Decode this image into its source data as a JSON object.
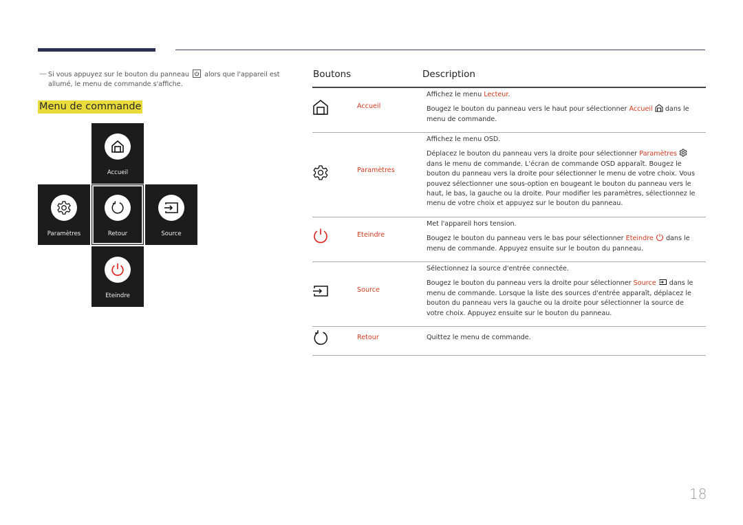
{
  "page": {
    "number": "18",
    "accent_red": "#d0381e",
    "highlight_yellow": "#e9dc3a",
    "header_bar_color": "#2b3050"
  },
  "note": {
    "dash": "―",
    "text_before": "Si vous appuyez sur le bouton du panneau",
    "key_icon": "power-button-icon",
    "text_after": "alors que l'appareil est allumé, le menu de commande s'affiche."
  },
  "menu": {
    "title": "Menu de commande",
    "tiles": [
      {
        "id": "accueil",
        "label": "Accueil",
        "icon": "home-icon"
      },
      {
        "id": "parametres",
        "label": "Paramètres",
        "icon": "gear-icon"
      },
      {
        "id": "retour",
        "label": "Retour",
        "icon": "return-icon"
      },
      {
        "id": "source",
        "label": "Source",
        "icon": "source-input-icon"
      },
      {
        "id": "eteindre",
        "label": "Eteindre",
        "icon": "power-icon"
      }
    ]
  },
  "table": {
    "headers": {
      "buttons": "Boutons",
      "description": "Description"
    },
    "rows": [
      {
        "name": "Accueil",
        "icon": "home-icon",
        "p1_before": "Affichez le menu ",
        "p1_red": "Lecteur",
        "p1_after": ".",
        "p2_before": "Bougez le bouton du panneau vers le haut pour sélectionner ",
        "p2_red": "Accueil",
        "p2_after": " dans le menu de commande."
      },
      {
        "name": "Paramètres",
        "icon": "gear-icon",
        "p1": "Affichez le menu OSD.",
        "p2_before": "Déplacez le bouton du panneau vers la droite pour sélectionner ",
        "p2_red": "Paramètres",
        "p2_after": " dans le menu de commande. L'écran de commande OSD apparaît. Bougez le bouton du panneau vers la droite pour sélectionner le menu de votre choix. Vous pouvez sélectionner une sous-option en bougeant le bouton du panneau vers le haut, le bas, la gauche ou la droite. Pour modifier les paramètres, sélectionnez le menu de votre choix et appuyez sur le bouton du panneau."
      },
      {
        "name": "Eteindre",
        "icon": "power-icon",
        "p1": "Met l'appareil hors tension.",
        "p2_before": "Bougez le bouton du panneau vers le bas pour sélectionner ",
        "p2_red": "Eteindre",
        "p2_after": " dans le menu de commande. Appuyez ensuite sur le bouton du panneau."
      },
      {
        "name": "Source",
        "icon": "source-input-icon",
        "p1": "Sélectionnez la source d'entrée connectée.",
        "p2_before": "Bougez le bouton du panneau vers la droite pour sélectionner ",
        "p2_red": "Source",
        "p2_after": " dans le menu de commande. Lorsque la liste des sources d'entrée apparaît, déplacez le bouton du panneau vers la gauche ou la droite pour sélectionner la source de votre choix. Appuyez ensuite sur le bouton du panneau."
      },
      {
        "name": "Retour",
        "icon": "return-icon",
        "p1": "Quittez le menu de commande."
      }
    ]
  }
}
